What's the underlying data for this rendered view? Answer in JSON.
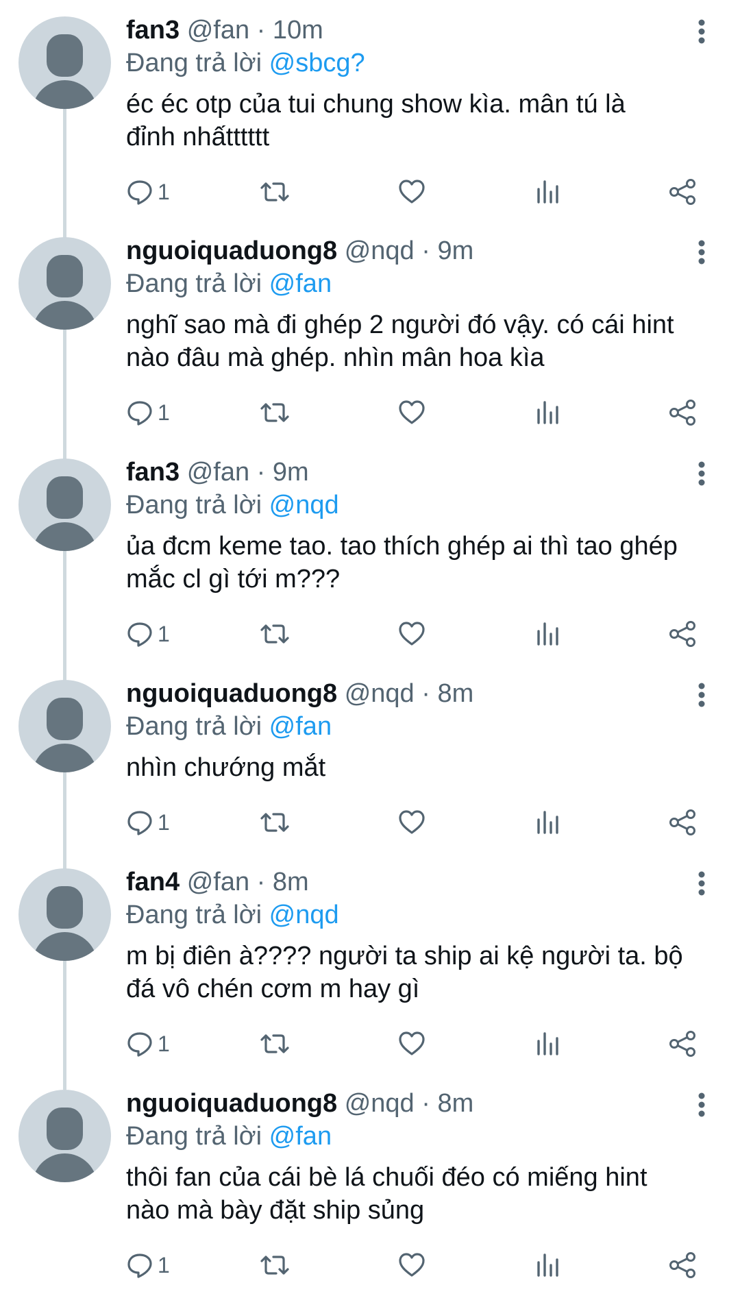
{
  "tweets": [
    {
      "name": "fan3",
      "handle": "@fan",
      "separator": "·",
      "time": "10m",
      "reply_prefix": "Đang trả lời ",
      "reply_to": "@sbcg?",
      "text_lines": [
        "éc éc otp của tui chung show kìa. mân tú là",
        "đỉnh nhấtttttt"
      ],
      "reply_count": "1"
    },
    {
      "name": "nguoiquaduong8",
      "handle": "@nqd",
      "separator": "·",
      "time": "9m",
      "reply_prefix": "Đang trả lời ",
      "reply_to": "@fan",
      "text_lines": [
        "nghĩ sao mà đi ghép 2 người đó vậy. có cái hint",
        "nào đâu mà ghép. nhìn mân hoa kìa"
      ],
      "reply_count": "1"
    },
    {
      "name": "fan3",
      "handle": "@fan",
      "separator": "·",
      "time": "9m",
      "reply_prefix": "Đang trả lời ",
      "reply_to": "@nqd",
      "text_lines": [
        "ủa đcm keme tao. tao thích ghép ai thì tao ghép",
        "mắc cl gì tới m???"
      ],
      "reply_count": "1"
    },
    {
      "name": "nguoiquaduong8",
      "handle": "@nqd",
      "separator": "·",
      "time": "8m",
      "reply_prefix": "Đang trả lời ",
      "reply_to": "@fan",
      "text_lines": [
        "nhìn chướng mắt",
        ""
      ],
      "reply_count": "1"
    },
    {
      "name": "fan4",
      "handle": "@fan",
      "separator": "·",
      "time": "8m",
      "reply_prefix": "Đang trả lời ",
      "reply_to": "@nqd",
      "text_lines": [
        "m bị điên à???? người ta ship ai kệ người ta. bộ",
        "đá vô chén cơm m hay gì"
      ],
      "reply_count": "1"
    },
    {
      "name": "nguoiquaduong8",
      "handle": "@nqd",
      "separator": "·",
      "time": "8m",
      "reply_prefix": "Đang trả lời ",
      "reply_to": "@fan",
      "text_lines": [
        "thôi fan của cái bè lá chuối đéo có miếng hint",
        "nào mà bày đặt ship sủng"
      ],
      "reply_count": "1"
    }
  ],
  "icons": {
    "reply": "speech-bubble-icon",
    "retweet": "retweet-icon",
    "like": "heart-icon",
    "views": "bar-chart-icon",
    "share": "share-icon",
    "more": "vertical-ellipsis-icon"
  },
  "colors": {
    "text": "#0f1419",
    "secondary": "#536471",
    "mention": "#1d9bf0",
    "thread_line": "#cfd9de",
    "avatar_bg": "#ccd6dd",
    "avatar_fg": "#66757f"
  }
}
